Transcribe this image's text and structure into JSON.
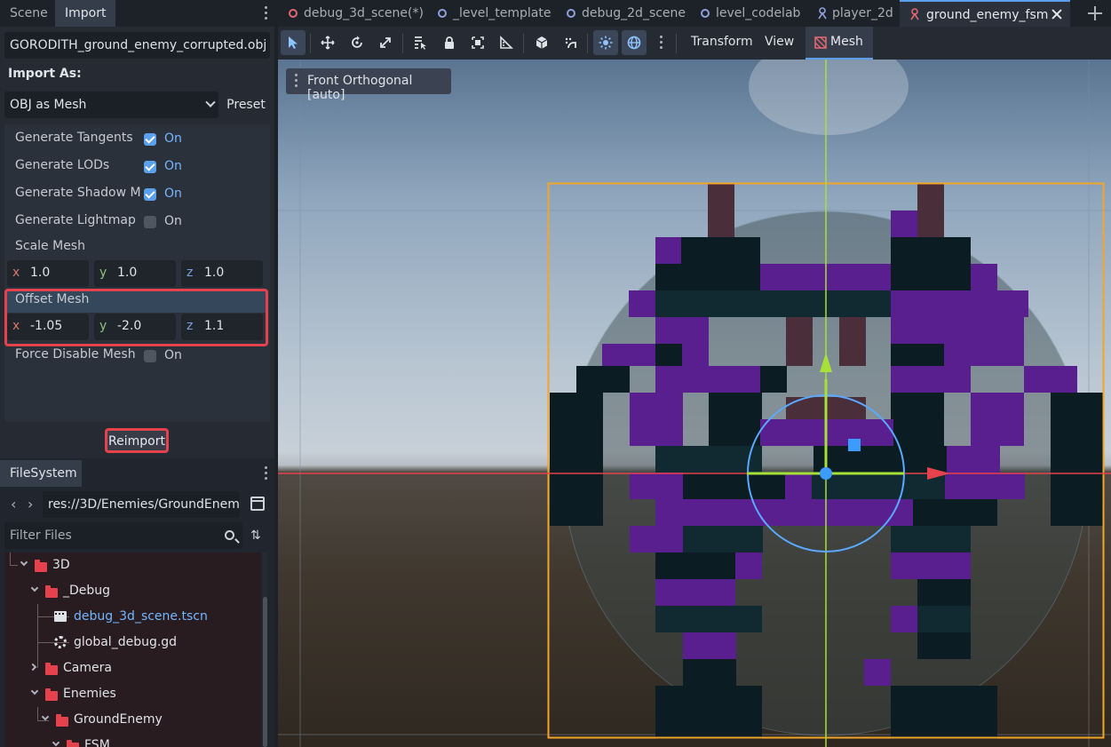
{
  "left_dock": {
    "tabs": [
      "Scene",
      "Import"
    ],
    "active_tab": "Import"
  },
  "import_panel": {
    "file_name": "GORODITH_ground_enemy_corrupted.obj",
    "import_as_label": "Import As:",
    "import_as_value": "OBJ as Mesh",
    "preset_label": "Preset",
    "properties": {
      "generate_tangents": {
        "label": "Generate Tangents",
        "checked": true,
        "state_text": "On"
      },
      "generate_lods": {
        "label": "Generate LODs",
        "checked": true,
        "state_text": "On"
      },
      "generate_shadow": {
        "label": "Generate Shadow M",
        "checked": true,
        "state_text": "On"
      },
      "generate_lightmap": {
        "label": "Generate Lightmap",
        "checked": false,
        "state_text": "On"
      },
      "scale_mesh": {
        "label": "Scale Mesh",
        "x": "1.0",
        "y": "1.0",
        "z": "1.0"
      },
      "offset_mesh": {
        "label": "Offset Mesh",
        "x": "-1.05",
        "y": "-2.0",
        "z": "1.1"
      },
      "force_disable_mesh": {
        "label": "Force Disable Mesh",
        "checked": false,
        "state_text": "On"
      }
    },
    "axis_labels": {
      "x": "x",
      "y": "y",
      "z": "z"
    },
    "reimport_label": "Reimport"
  },
  "filesystem": {
    "tab_label": "FileSystem",
    "path": "res://3D/Enemies/GroundEnem",
    "filter_placeholder": "Filter Files",
    "tree": [
      {
        "label": "3D",
        "type": "folder",
        "expanded": true
      },
      {
        "label": "_Debug",
        "type": "folder",
        "expanded": true
      },
      {
        "label": "debug_3d_scene.tscn",
        "type": "scene",
        "highlight": true
      },
      {
        "label": "global_debug.gd",
        "type": "script"
      },
      {
        "label": "Camera",
        "type": "folder",
        "expanded": false
      },
      {
        "label": "Enemies",
        "type": "folder",
        "expanded": true
      },
      {
        "label": "GroundEnemy",
        "type": "folder",
        "expanded": true
      },
      {
        "label": "FSM",
        "type": "folder",
        "expanded": true
      }
    ]
  },
  "scene_tabs": [
    {
      "label": "debug_3d_scene(*)",
      "icon": "circle-red-icon"
    },
    {
      "label": "_level_template",
      "icon": "circle-blue-icon"
    },
    {
      "label": "debug_2d_scene",
      "icon": "circle-blue-icon"
    },
    {
      "label": "level_codelab",
      "icon": "circle-blue-icon"
    },
    {
      "label": "player_2d",
      "icon": "node-blue-icon"
    },
    {
      "label": "ground_enemy_fsm",
      "icon": "node-red-icon",
      "active": true
    }
  ],
  "toolbar": {
    "transform_menu": "Transform",
    "view_menu": "View",
    "mesh_menu": "Mesh"
  },
  "viewport": {
    "view_label": "Front Orthogonal [auto]"
  },
  "colors": {
    "accent": "#5aa0ea",
    "highlight_red": "#e5424d",
    "enemy_purple": "#5a1f8f",
    "enemy_dark": "#0b1c22",
    "bbox_orange": "#f2a52a"
  }
}
